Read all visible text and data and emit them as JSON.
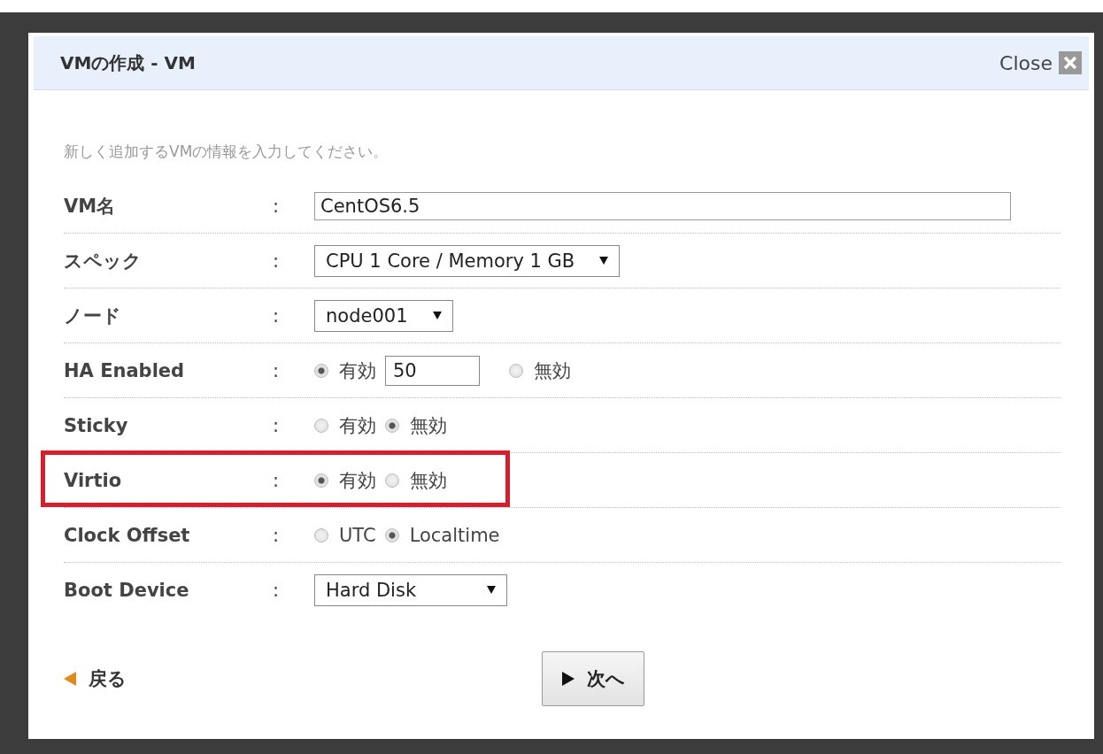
{
  "dialog": {
    "title": "VMの作成 - VM",
    "close_label": "Close",
    "intro": "新しく追加するVMの情報を入力してください。",
    "fields": [
      {
        "kind": "text",
        "label": "VM名",
        "separator": ":",
        "value": "CentOS6.5",
        "highlighted": false
      },
      {
        "kind": "select",
        "label": "スペック",
        "separator": ":",
        "value": "CPU 1 Core / Memory 1 GB",
        "highlighted": false
      },
      {
        "kind": "select",
        "label": "ノード",
        "separator": ":",
        "value": "node001",
        "highlighted": false
      },
      {
        "kind": "radio",
        "label": "HA Enabled",
        "separator": ":",
        "highlighted": false,
        "options": [
          {
            "label": "有効",
            "selected": true,
            "input_value": "50"
          },
          {
            "label": "無効",
            "selected": false
          }
        ]
      },
      {
        "kind": "radio",
        "label": "Sticky",
        "separator": ":",
        "highlighted": false,
        "options": [
          {
            "label": "有効",
            "selected": false
          },
          {
            "label": "無効",
            "selected": true
          }
        ]
      },
      {
        "kind": "radio",
        "label": "Virtio",
        "separator": ":",
        "highlighted": true,
        "options": [
          {
            "label": "有効",
            "selected": true
          },
          {
            "label": "無効",
            "selected": false
          }
        ]
      },
      {
        "kind": "radio",
        "label": "Clock Offset",
        "separator": ":",
        "highlighted": false,
        "options": [
          {
            "label": "UTC",
            "selected": false
          },
          {
            "label": "Localtime",
            "selected": true
          }
        ]
      },
      {
        "kind": "select",
        "label": "Boot Device",
        "separator": ":",
        "value": "Hard Disk",
        "highlighted": false
      }
    ],
    "back_link": "戻る",
    "next_button": "次へ"
  }
}
